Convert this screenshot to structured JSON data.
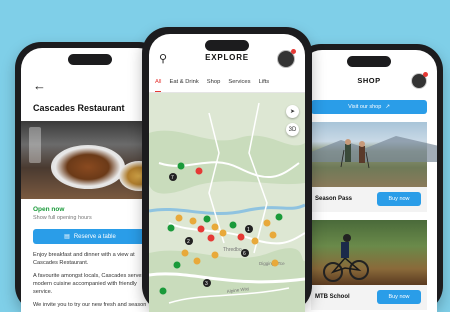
{
  "left_screen": {
    "back_icon": "arrow-left-icon",
    "title": "Cascades Restaurant",
    "status": "Open now",
    "hours_link": "Show full opening hours",
    "reserve_label": "Reserve a table",
    "body": [
      "Enjoy breakfast and dinner with a view at Cascades Restaurant.",
      "A favourite amongst locals, Cascades serves modern cuisine accompanied with friendly service.",
      "We invite you to try our new fresh and season"
    ]
  },
  "center_screen": {
    "title": "EXPLORE",
    "tabs": [
      "All",
      "Eat & Drink",
      "Shop",
      "Services",
      "Lifts"
    ],
    "active_tab": "All",
    "map_labels": [
      "Thredbo",
      "Alpine Way",
      "Diggings Tce"
    ],
    "map_markers": [
      "1",
      "2",
      "3",
      "6",
      "7"
    ]
  },
  "right_screen": {
    "title": "SHOP",
    "visit_label": "Visit our shop",
    "cards": [
      {
        "label": "Season Pass",
        "button": "Buy now"
      },
      {
        "label": "MTB School",
        "button": "Buy now"
      }
    ]
  },
  "colors": {
    "background": "#7fcfe8",
    "accent_blue": "#2a9de8",
    "accent_red": "#e53935",
    "open_green": "#1a9a3a"
  }
}
